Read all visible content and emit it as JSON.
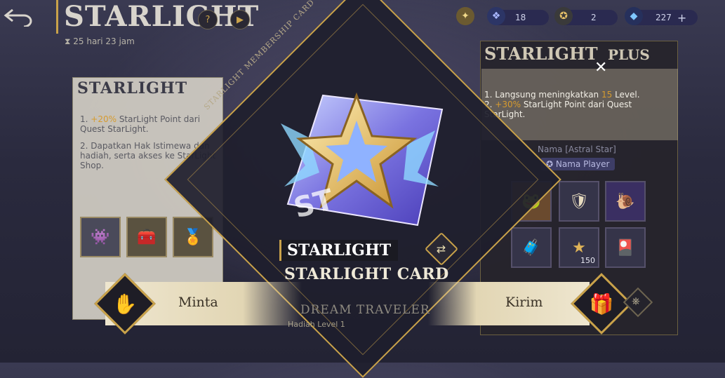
{
  "header": {
    "title": "STARLIGHT",
    "help_icon": "question-icon",
    "play_icon": "play-icon",
    "countdown": "25 hari 23 jam"
  },
  "currencies": [
    {
      "icon": "battle-points-icon",
      "value": "18"
    },
    {
      "icon": "tickets-icon",
      "value": "2"
    },
    {
      "icon": "diamond-icon",
      "value": "227"
    }
  ],
  "left_panel": {
    "title": "STARLIGHT",
    "perks": [
      {
        "highlight": "+20%",
        "text": " StarLight Point dari Quest StarLight."
      },
      {
        "highlight": "",
        "text": "Dapatkan Hak Istimewa dan hadiah, serta akses ke StarLight Shop."
      }
    ]
  },
  "center_card": {
    "arc_text": "STARLIGHT MEMBERSHIP CARD",
    "art_text": "ST",
    "tag": "STARLIGHT",
    "name": "STARLIGHT CARD",
    "footer_text": "DREAM TRAVELER",
    "footer_sub": "Hadiah Level 1"
  },
  "right_panel": {
    "title": "STARLIGHT",
    "title_suffix": "PLUS",
    "perk1_pre": "1. Langsung meningkatkan ",
    "perk1_hl": "15",
    "perk1_post": " Level.",
    "perk2_pre": "2. ",
    "perk2_hl": "+30%",
    "perk2_post": " StarLight Point dari Quest StarLight.",
    "name_label": "Nama [Astral Star]",
    "player_label": "Nama Player",
    "item_count": "150"
  },
  "actions": {
    "request_label": "Minta",
    "send_label": "Kirim"
  },
  "colors": {
    "accent_gold": "#c9a24a",
    "highlight": "#d69b2e"
  }
}
